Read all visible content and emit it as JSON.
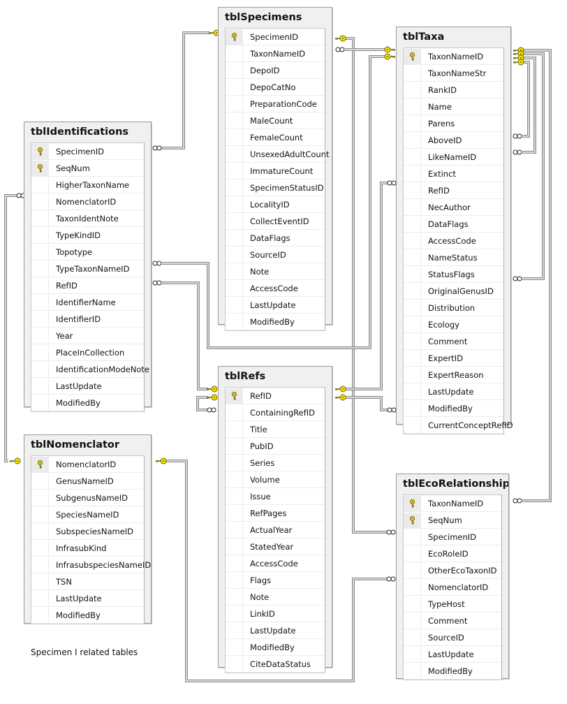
{
  "caption": "Specimen I related tables",
  "tables": {
    "specimens": {
      "name": "tblSpecimens",
      "columns": [
        {
          "name": "SpecimenID",
          "pk": true
        },
        {
          "name": "TaxonNameID"
        },
        {
          "name": "DepoID"
        },
        {
          "name": "DepoCatNo"
        },
        {
          "name": "PreparationCode"
        },
        {
          "name": "MaleCount"
        },
        {
          "name": "FemaleCount"
        },
        {
          "name": "UnsexedAdultCount"
        },
        {
          "name": "ImmatureCount"
        },
        {
          "name": "SpecimenStatusID"
        },
        {
          "name": "LocalityID"
        },
        {
          "name": "CollectEventID"
        },
        {
          "name": "DataFlags"
        },
        {
          "name": "SourceID"
        },
        {
          "name": "Note"
        },
        {
          "name": "AccessCode"
        },
        {
          "name": "LastUpdate"
        },
        {
          "name": "ModifiedBy"
        }
      ]
    },
    "taxa": {
      "name": "tblTaxa",
      "columns": [
        {
          "name": "TaxonNameID",
          "pk": true
        },
        {
          "name": "TaxonNameStr"
        },
        {
          "name": "RankID"
        },
        {
          "name": "Name"
        },
        {
          "name": "Parens"
        },
        {
          "name": "AboveID"
        },
        {
          "name": "LikeNameID"
        },
        {
          "name": "Extinct"
        },
        {
          "name": "RefID"
        },
        {
          "name": "NecAuthor"
        },
        {
          "name": "DataFlags"
        },
        {
          "name": "AccessCode"
        },
        {
          "name": "NameStatus"
        },
        {
          "name": "StatusFlags"
        },
        {
          "name": "OriginalGenusID"
        },
        {
          "name": "Distribution"
        },
        {
          "name": "Ecology"
        },
        {
          "name": "Comment"
        },
        {
          "name": "ExpertID"
        },
        {
          "name": "ExpertReason"
        },
        {
          "name": "LastUpdate"
        },
        {
          "name": "ModifiedBy"
        },
        {
          "name": "CurrentConceptRefID"
        }
      ]
    },
    "identifications": {
      "name": "tblIdentifications",
      "columns": [
        {
          "name": "SpecimenID",
          "pk": true
        },
        {
          "name": "SeqNum",
          "pk": true
        },
        {
          "name": "HigherTaxonName"
        },
        {
          "name": "NomenclatorID"
        },
        {
          "name": "TaxonIdentNote"
        },
        {
          "name": "TypeKindID"
        },
        {
          "name": "Topotype"
        },
        {
          "name": "TypeTaxonNameID"
        },
        {
          "name": "RefID"
        },
        {
          "name": "IdentifierName"
        },
        {
          "name": "IdentifierID"
        },
        {
          "name": "Year"
        },
        {
          "name": "PlaceInCollection"
        },
        {
          "name": "IdentificationModeNote"
        },
        {
          "name": "LastUpdate"
        },
        {
          "name": "ModifiedBy"
        }
      ]
    },
    "refs": {
      "name": "tblRefs",
      "columns": [
        {
          "name": "RefID",
          "pk": true
        },
        {
          "name": "ContainingRefID"
        },
        {
          "name": "Title"
        },
        {
          "name": "PubID"
        },
        {
          "name": "Series"
        },
        {
          "name": "Volume"
        },
        {
          "name": "Issue"
        },
        {
          "name": "RefPages"
        },
        {
          "name": "ActualYear"
        },
        {
          "name": "StatedYear"
        },
        {
          "name": "AccessCode"
        },
        {
          "name": "Flags"
        },
        {
          "name": "Note"
        },
        {
          "name": "LinkID"
        },
        {
          "name": "LastUpdate"
        },
        {
          "name": "ModifiedBy"
        },
        {
          "name": "CiteDataStatus"
        }
      ]
    },
    "nomenclator": {
      "name": "tblNomenclator",
      "columns": [
        {
          "name": "NomenclatorID",
          "pk": true
        },
        {
          "name": "GenusNameID"
        },
        {
          "name": "SubgenusNameID"
        },
        {
          "name": "SpeciesNameID"
        },
        {
          "name": "SubspeciesNameID"
        },
        {
          "name": "InfrasubKind"
        },
        {
          "name": "InfrasubspeciesNameID"
        },
        {
          "name": "TSN"
        },
        {
          "name": "LastUpdate"
        },
        {
          "name": "ModifiedBy"
        }
      ]
    },
    "ecorelationships": {
      "name": "tblEcoRelationships",
      "columns": [
        {
          "name": "TaxonNameID",
          "pk": true
        },
        {
          "name": "SeqNum",
          "pk": true
        },
        {
          "name": "SpecimenID"
        },
        {
          "name": "EcoRoleID"
        },
        {
          "name": "OtherEcoTaxonID"
        },
        {
          "name": "NomenclatorID"
        },
        {
          "name": "TypeHost"
        },
        {
          "name": "Comment"
        },
        {
          "name": "SourceID"
        },
        {
          "name": "LastUpdate"
        },
        {
          "name": "ModifiedBy"
        }
      ]
    }
  },
  "relationships": [
    {
      "from": "tblSpecimens.SpecimenID",
      "to": "tblIdentifications.SpecimenID",
      "type": "one-to-many"
    },
    {
      "from": "tblTaxa.TaxonNameID",
      "to": "tblSpecimens.TaxonNameID",
      "type": "one-to-many"
    },
    {
      "from": "tblSpecimens.SpecimenID",
      "to": "tblEcoRelationships.SpecimenID",
      "type": "one-to-many"
    },
    {
      "from": "tblTaxa.TaxonNameID",
      "to": "tblIdentifications.TypeTaxonNameID",
      "type": "one-to-many"
    },
    {
      "from": "tblRefs.RefID",
      "to": "tblIdentifications.RefID",
      "type": "one-to-many"
    },
    {
      "from": "tblNomenclator.NomenclatorID",
      "to": "tblIdentifications.NomenclatorID",
      "type": "one-to-many"
    },
    {
      "from": "tblRefs.RefID",
      "to": "tblRefs.ContainingRefID",
      "type": "one-to-many"
    },
    {
      "from": "tblRefs.RefID",
      "to": "tblTaxa.RefID",
      "type": "one-to-many"
    },
    {
      "from": "tblRefs.RefID",
      "to": "tblTaxa.CurrentConceptRefID",
      "type": "one-to-many"
    },
    {
      "from": "tblTaxa.TaxonNameID",
      "to": "tblTaxa.AboveID",
      "type": "one-to-many"
    },
    {
      "from": "tblTaxa.TaxonNameID",
      "to": "tblTaxa.LikeNameID",
      "type": "one-to-many"
    },
    {
      "from": "tblTaxa.TaxonNameID",
      "to": "tblTaxa.OriginalGenusID",
      "type": "one-to-many"
    },
    {
      "from": "tblTaxa.TaxonNameID",
      "to": "tblEcoRelationships.TaxonNameID",
      "type": "one-to-many"
    },
    {
      "from": "tblNomenclator.NomenclatorID",
      "to": "tblEcoRelationships.NomenclatorID",
      "type": "one-to-many"
    }
  ]
}
